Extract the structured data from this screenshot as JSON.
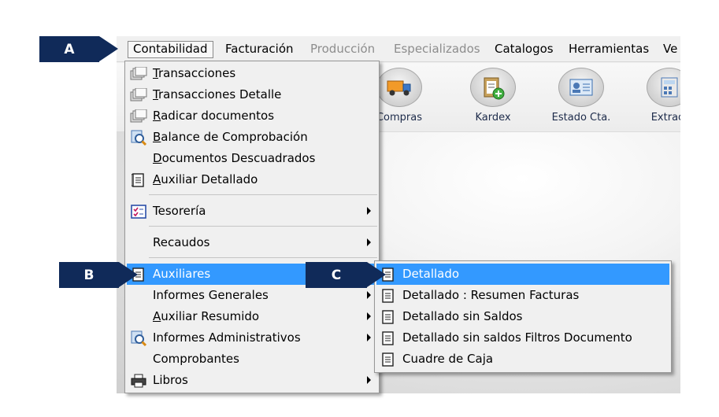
{
  "menubar": {
    "items": [
      {
        "label": "Contabilidad",
        "state": "open"
      },
      {
        "label": "Facturación",
        "state": "enabled"
      },
      {
        "label": "Producción",
        "state": "disabled"
      },
      {
        "label": "Especializados",
        "state": "disabled"
      },
      {
        "label": "Catalogos",
        "state": "enabled"
      },
      {
        "label": "Herramientas",
        "state": "enabled"
      },
      {
        "label": "Ve",
        "state": "enabled"
      }
    ]
  },
  "toolbar": {
    "buttons": [
      {
        "label": "Compras",
        "icon": "truck-icon"
      },
      {
        "label": "Kardex",
        "icon": "clipboard-add-icon"
      },
      {
        "label": "Estado Cta.",
        "icon": "id-card-icon"
      },
      {
        "label": "Extract",
        "icon": "calculator-icon"
      }
    ]
  },
  "contabilidad_menu": {
    "items": [
      {
        "label": "Transacciones",
        "icon": "documents-icon",
        "accel": "T"
      },
      {
        "label": "Transacciones Detalle",
        "icon": "documents-icon",
        "accel": "T"
      },
      {
        "label": "Radicar documentos",
        "icon": "documents-icon",
        "accel": "R"
      },
      {
        "label": "Balance de Comprobación",
        "icon": "magnifier-icon",
        "accel": "B"
      },
      {
        "label": "Documentos Descuadrados",
        "icon": "",
        "accel": "D"
      },
      {
        "label": "Auxiliar Detallado",
        "icon": "ledger-icon",
        "accel": "A"
      },
      {
        "label": "Tesorería",
        "icon": "checklist-icon",
        "submenu": true
      },
      {
        "label": "Recaudos",
        "icon": "",
        "submenu": true
      },
      {
        "label": "Auxiliares",
        "icon": "ledger-icon",
        "submenu": true,
        "highlighted": true
      },
      {
        "label": "Informes Generales",
        "icon": "",
        "submenu": true
      },
      {
        "label": "Auxiliar Resumido",
        "icon": "",
        "submenu": true,
        "accel": "A"
      },
      {
        "label": "Informes Administrativos",
        "icon": "magnifier-icon",
        "submenu": true
      },
      {
        "label": "Comprobantes",
        "icon": ""
      },
      {
        "label": "Libros",
        "icon": "printer-icon",
        "submenu": true
      }
    ]
  },
  "auxiliares_submenu": {
    "items": [
      {
        "label": "Detallado",
        "icon": "ledger-icon",
        "highlighted": true
      },
      {
        "label": "Detallado : Resumen Facturas",
        "icon": "ledger-icon"
      },
      {
        "label": "Detallado sin Saldos",
        "icon": "ledger-icon"
      },
      {
        "label": "Detallado sin saldos Filtros Documento",
        "icon": "ledger-icon"
      },
      {
        "label": "Cuadre de Caja",
        "icon": "ledger-icon"
      }
    ]
  },
  "callouts": [
    {
      "label": "A"
    },
    {
      "label": "B"
    },
    {
      "label": "C"
    }
  ],
  "colors": {
    "callout": "#102a59",
    "highlight": "#3399ff",
    "menu_bg": "#f0f0f0"
  }
}
